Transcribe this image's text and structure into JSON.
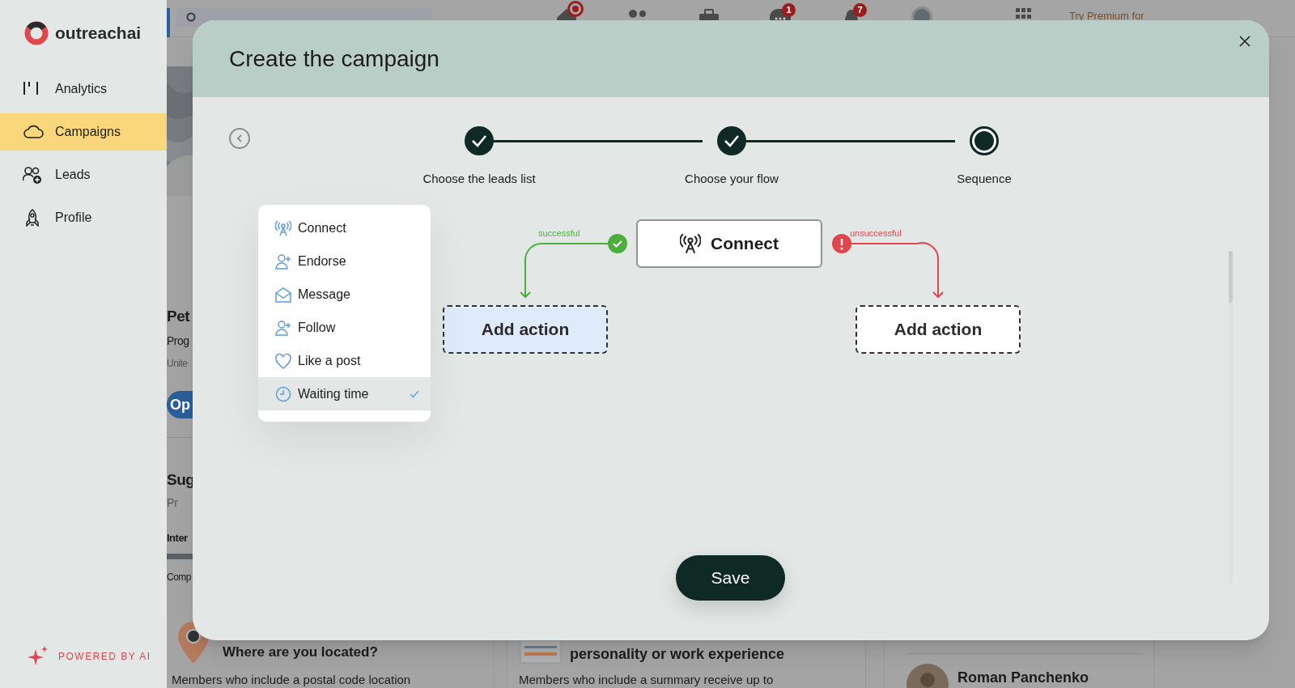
{
  "sidebar": {
    "brand": "outreachai",
    "items": [
      {
        "label": "Analytics",
        "selected": false
      },
      {
        "label": "Campaigns",
        "selected": true
      },
      {
        "label": "Leads",
        "selected": false
      },
      {
        "label": "Profile",
        "selected": false
      }
    ],
    "footer": "POWERED BY AI"
  },
  "background_page": {
    "top_bar": {
      "badges": [
        {
          "kind": "dot"
        },
        {
          "kind": "none"
        },
        {
          "kind": "none"
        },
        {
          "kind": "count",
          "text": "1"
        },
        {
          "kind": "count",
          "text": "7"
        }
      ],
      "premium_link": "Try Premium for"
    },
    "profile_fragments": [
      "Pet",
      "Prog",
      "Unite"
    ],
    "open_button": "Op",
    "suggested_fragments": [
      "Sug",
      "Pr",
      "Inter",
      "Comp"
    ],
    "progress_bar": {
      "level": 1
    },
    "cards": [
      {
        "title": "Where are you located?",
        "text": "Members who include a postal code location"
      },
      {
        "title": "personality or work experience",
        "text": "Members who include a summary receive up to"
      }
    ],
    "person": "Roman Panchenko"
  },
  "modal": {
    "title": "Create the campaign",
    "steps": [
      {
        "label": "Choose the leads list",
        "completed": true
      },
      {
        "label": "Choose your flow",
        "completed": true
      },
      {
        "label": "Sequence",
        "completed": false
      }
    ],
    "action_menu": [
      {
        "label": "Connect",
        "kind": "antenna",
        "selected": false
      },
      {
        "label": "Endorse",
        "kind": "user-plus",
        "selected": false
      },
      {
        "label": "Message",
        "kind": "envelope",
        "selected": false
      },
      {
        "label": "Follow",
        "kind": "user-plus",
        "selected": false
      },
      {
        "label": "Like a post",
        "kind": "heart",
        "selected": false
      },
      {
        "label": "Waiting time",
        "kind": "clock",
        "selected": true
      }
    ],
    "flow": {
      "root": "Connect",
      "branches": [
        {
          "label": "successful",
          "successful": true,
          "action": "Add action",
          "highlighted": true
        },
        {
          "label": "unsuccessful",
          "successful": false,
          "action": "Add action",
          "highlighted": false
        }
      ]
    },
    "save_button": "Save"
  }
}
